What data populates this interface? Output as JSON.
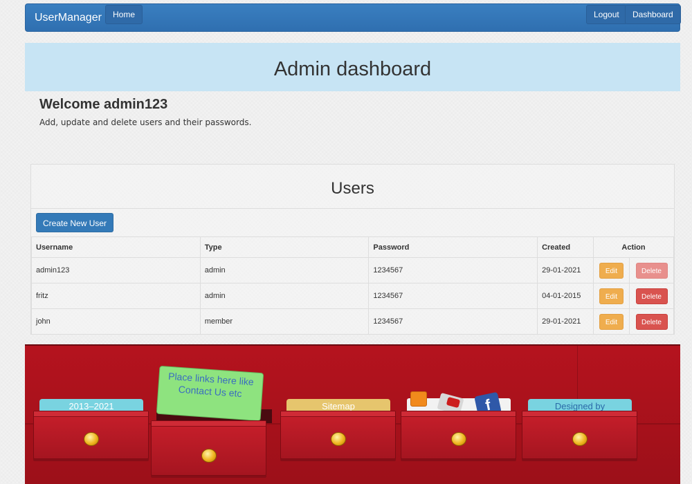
{
  "navbar": {
    "brand": "UserManager",
    "home": "Home",
    "logout": "Logout",
    "dashboard": "Dashboard"
  },
  "hero": {
    "title": "Admin dashboard"
  },
  "welcome": {
    "heading": "Welcome admin123",
    "description": "Add, update and delete users and their passwords."
  },
  "users_panel": {
    "title": "Users",
    "create_button": "Create New User",
    "columns": [
      "Username",
      "Type",
      "Password",
      "Created",
      "Action"
    ],
    "rows": [
      {
        "username": "admin123",
        "type": "admin",
        "password": "1234567",
        "created": "29-01-2021",
        "edit": "Edit",
        "delete": "Delete"
      },
      {
        "username": "fritz",
        "type": "admin",
        "password": "1234567",
        "created": "04-01-2015",
        "edit": "Edit",
        "delete": "Delete"
      },
      {
        "username": "john",
        "type": "member",
        "password": "1234567",
        "created": "29-01-2021",
        "edit": "Edit",
        "delete": "Delete"
      }
    ]
  },
  "footer": {
    "tab_1": "2013–2021",
    "note": "Place links here like Contact Us etc",
    "tab_2": "Sitemap",
    "tab_3": "Designed by",
    "icons": [
      "rss-icon",
      "youtube-icon",
      "facebook-icon"
    ]
  },
  "colors": {
    "navbar": "#337ab7",
    "hero": "#c7e4f4",
    "edit": "#f0ad4e",
    "delete": "#d9534f",
    "footer": "#b5131e"
  }
}
